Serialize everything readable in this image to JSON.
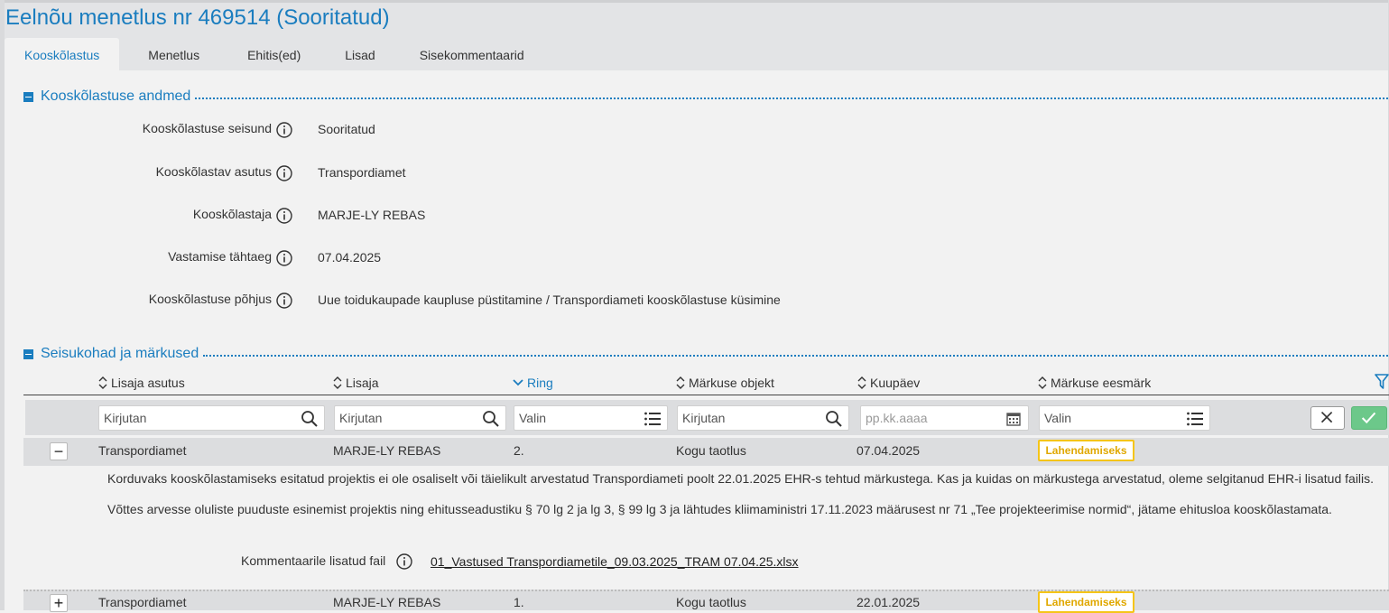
{
  "header": {
    "title": "Eelnõu menetlus nr 469514 (Sooritatud)"
  },
  "tabs": [
    {
      "label": "Kooskõlastus",
      "active": true
    },
    {
      "label": "Menetlus"
    },
    {
      "label": "Ehitis(ed)"
    },
    {
      "label": "Lisad"
    },
    {
      "label": "Sisekommentaarid"
    }
  ],
  "approval_section": {
    "title": "Kooskõlastuse andmed",
    "fields": [
      {
        "label": "Kooskõlastuse seisund",
        "value": "Sooritatud"
      },
      {
        "label": "Kooskõlastav asutus",
        "value": "Transpordiamet"
      },
      {
        "label": "Kooskõlastaja",
        "value": "MARJE-LY REBAS"
      },
      {
        "label": "Vastamise tähtaeg",
        "value": "07.04.2025"
      },
      {
        "label": "Kooskõlastuse põhjus",
        "value": "Uue toidukaupade kaupluse püstitamine / Transpordiameti kooskõlastuse küsimine"
      }
    ]
  },
  "remarks_section": {
    "title": "Seisukohad ja märkused",
    "columns": [
      {
        "label": "Lisaja asutus",
        "sort": "both"
      },
      {
        "label": "Lisaja",
        "sort": "both"
      },
      {
        "label": "Ring",
        "sort": "desc",
        "active": true
      },
      {
        "label": "Märkuse objekt",
        "sort": "both"
      },
      {
        "label": "Kuupäev",
        "sort": "both"
      },
      {
        "label": "Märkuse eesmärk",
        "sort": "both"
      }
    ],
    "filters": {
      "agency": {
        "placeholder": "Kirjutan",
        "icon": "search-icon"
      },
      "author": {
        "placeholder": "Kirjutan",
        "icon": "search-icon"
      },
      "round": {
        "placeholder": "Valin",
        "icon": "list-icon"
      },
      "object": {
        "placeholder": "Kirjutan",
        "icon": "search-icon"
      },
      "date": {
        "placeholder": "pp.kk.aaaa",
        "icon": "calendar-icon"
      },
      "purpose": {
        "placeholder": "Valin",
        "icon": "list-icon"
      }
    },
    "rows": [
      {
        "expanded": true,
        "agency": "Transpordiamet",
        "author": "MARJE-LY REBAS",
        "round": "2.",
        "object": "Kogu taotlus",
        "date": "07.04.2025",
        "purpose": "Lahendamiseks",
        "paragraphs": [
          "Korduvaks kooskõlastamiseks esitatud projektis ei ole osaliselt või täielikult arvestatud Transpordiameti poolt 22.01.2025 EHR-s tehtud märkustega. Kas ja kuidas on märkustega arvestatud, oleme selgitanud EHR-i lisatud failis.",
          "Võttes arvesse oluliste puuduste esinemist projektis ning ehitusseadustiku § 70 lg 2 ja lg 3, § 99 lg 3 ja lähtudes kliimaministri 17.11.2023 määrusest nr 71 „Tee projekteerimise normid“, jätame ehitusloa kooskõlastamata."
        ],
        "attachment_label": "Kommentaarile lisatud fail",
        "attachment_file": "01_Vastused Transpordiametile_09.03.2025_TRAM 07.04.25.xlsx"
      },
      {
        "expanded": false,
        "agency": "Transpordiamet",
        "author": "MARJE-LY REBAS",
        "round": "1.",
        "object": "Kogu taotlus",
        "date": "22.01.2025",
        "purpose": "Lahendamiseks"
      }
    ]
  },
  "colors": {
    "accent": "#1a7dbf",
    "badge_border": "#f5c518",
    "badge_text": "#e0a800",
    "confirm": "#6cc88a"
  }
}
